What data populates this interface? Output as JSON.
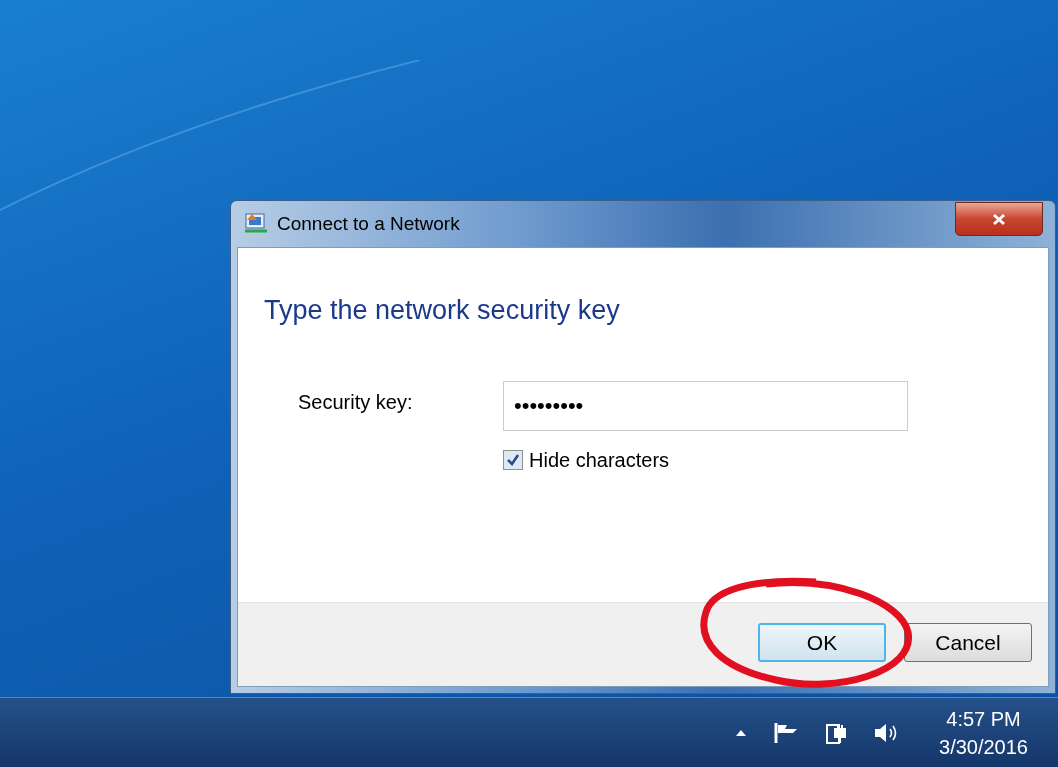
{
  "window": {
    "title": "Connect to a Network"
  },
  "heading": "Type the network security key",
  "security_key": {
    "label": "Security key:",
    "value": "•••••••••"
  },
  "hide_characters": {
    "label": "Hide characters",
    "checked": true
  },
  "buttons": [
    {
      "label": "OK",
      "selected": true
    },
    {
      "label": "Cancel",
      "selected": false
    }
  ],
  "taskbar": {
    "time": "4:57 PM",
    "date": "3/30/2016"
  }
}
